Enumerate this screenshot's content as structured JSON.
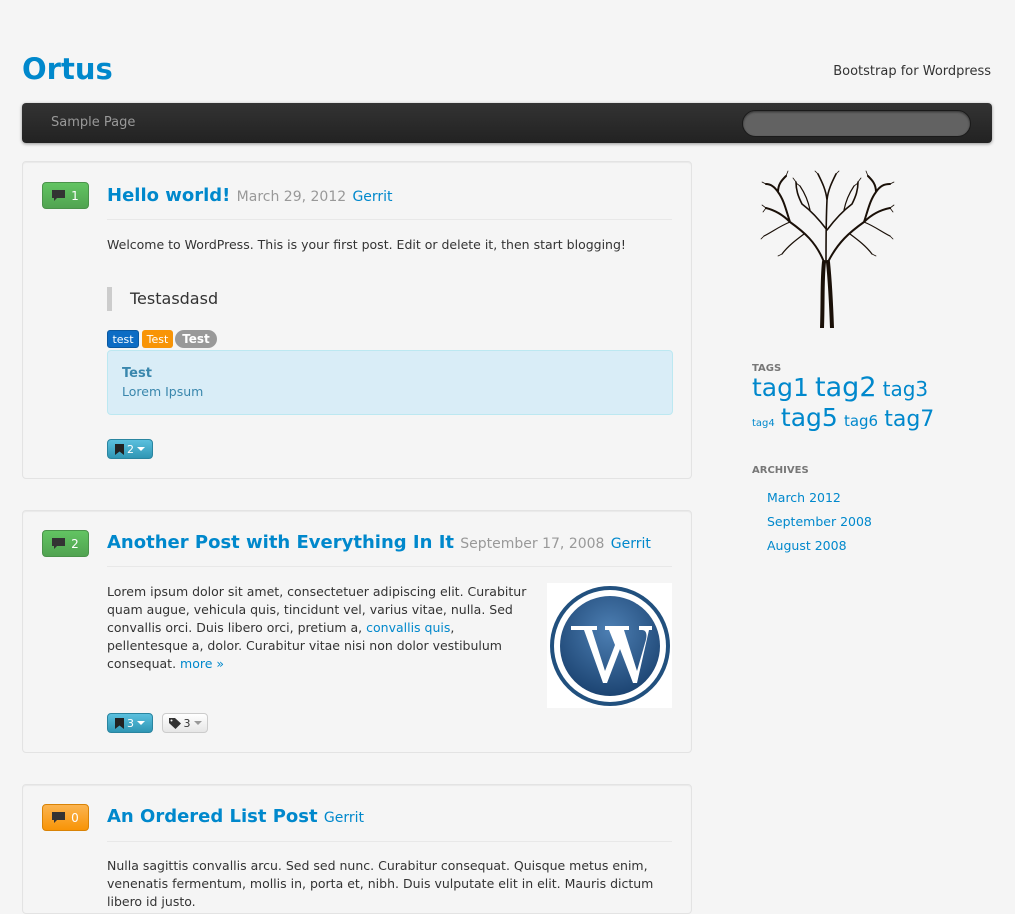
{
  "site": {
    "title": "Ortus",
    "description": "Bootstrap for Wordpress"
  },
  "nav": {
    "items": [
      "Sample Page"
    ],
    "search_placeholder": ""
  },
  "posts": [
    {
      "comments": "1",
      "title": "Hello world!",
      "date": "March 29, 2012",
      "author": "Gerrit",
      "body": "Welcome to WordPress. This is your first post. Edit or delete it, then start blogging!",
      "quote": "Testasdasd",
      "labels": [
        "test",
        "Test",
        "Test"
      ],
      "alert": {
        "title": "Test",
        "text": "Lorem Ipsum"
      },
      "bookmark_count": "2"
    },
    {
      "comments": "2",
      "title": "Another Post with Everything In It",
      "date": "September 17, 2008",
      "author": "Gerrit",
      "body_part1": "Lorem ipsum dolor sit amet, consectetuer adipiscing elit. Curabitur quam augue, vehicula quis, tincidunt vel, varius vitae, nulla. Sed convallis orci. Duis libero orci, pretium a, ",
      "body_link": "convallis quis",
      "body_part2": ", pellentesque a, dolor. Curabitur vitae nisi non dolor vestibulum consequat. ",
      "more_link": "more »",
      "bookmark_count": "3",
      "tag_count": "3"
    },
    {
      "comments": "0",
      "title": "An Ordered List Post",
      "author": "Gerrit",
      "body": "Nulla sagittis convallis arcu. Sed sed nunc. Curabitur consequat. Quisque metus enim, venenatis fermentum, mollis in, porta et, nibh. Duis vulputate elit in elit. Mauris dictum libero id justo."
    }
  ],
  "sidebar": {
    "tags_title": "TAGS",
    "tags": [
      "tag1",
      "tag2",
      "tag3",
      "tag4",
      "tag5",
      "tag6",
      "tag7"
    ],
    "archives_title": "ARCHIVES",
    "archives": [
      "March 2012",
      "September 2008",
      "August 2008"
    ]
  },
  "colors": {
    "link": "#0088cc",
    "navbar": "#222222",
    "success": "#51a351",
    "warning": "#f89406",
    "info": "#2f96b4"
  }
}
